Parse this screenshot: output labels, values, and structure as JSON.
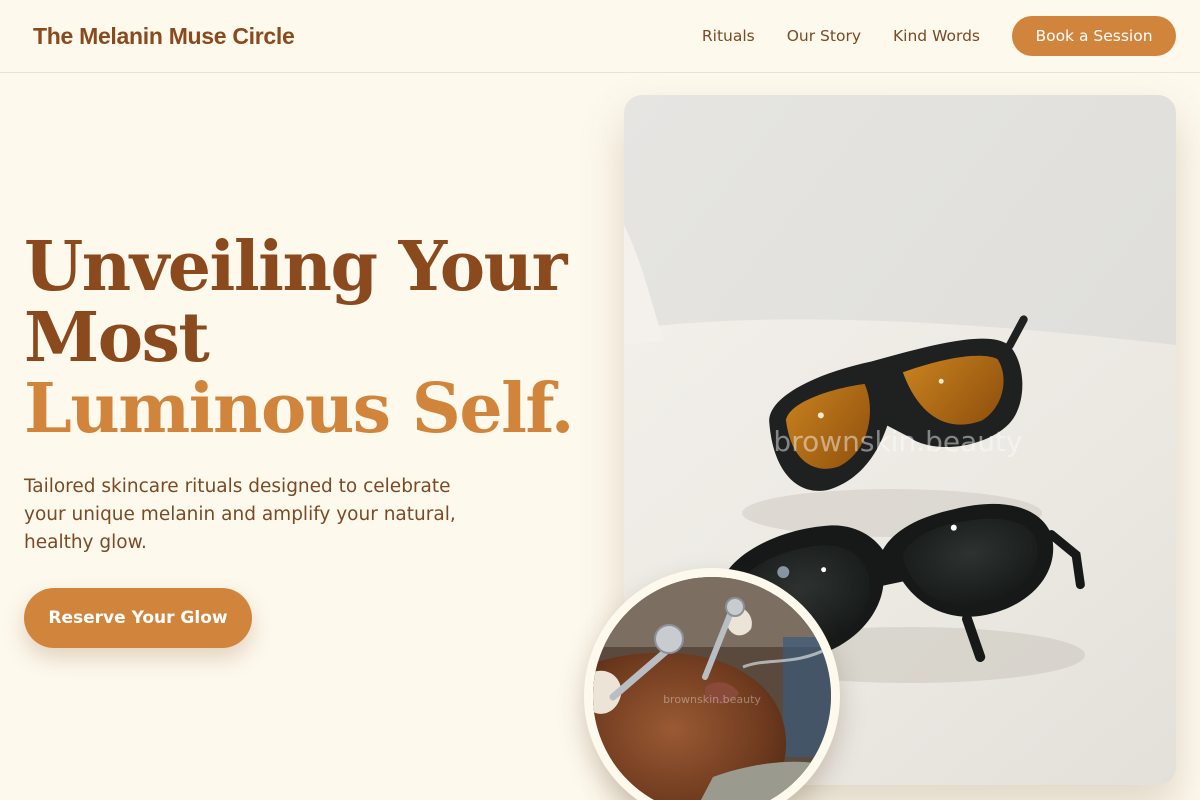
{
  "header": {
    "brand": "The Melanin Muse Circle",
    "nav": [
      "Rituals",
      "Our Story",
      "Kind Words"
    ],
    "cta": "Book a Session"
  },
  "hero": {
    "title_line1": "Unveiling Your",
    "title_line2": "Most",
    "title_accent": "Luminous Self.",
    "subtitle": "Tailored skincare rituals designed to celebrate your unique melanin and amplify your natural, healthy glow.",
    "cta": "Reserve Your Glow"
  },
  "images": {
    "main_watermark": "brownskin.beauty",
    "inset_watermark": "brownskin.beauty"
  },
  "colors": {
    "background": "#fdf9ed",
    "brand_brown": "#8a4a1e",
    "accent": "#d1853c"
  }
}
